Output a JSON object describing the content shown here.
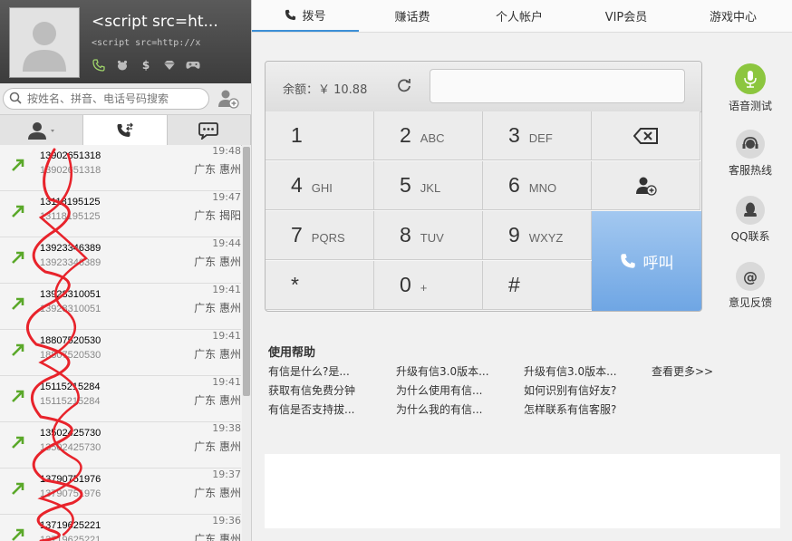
{
  "profile": {
    "name": "<script src=ht...",
    "sub": "<script src=http://x"
  },
  "search": {
    "placeholder": "按姓名、拼音、电话号码搜索"
  },
  "call_log": [
    {
      "number": "13902651318",
      "number_sub": "13902651318",
      "time": "19:48",
      "location": "广东 惠州"
    },
    {
      "number": "13118195125",
      "number_sub": "13118195125",
      "time": "19:47",
      "location": "广东 揭阳"
    },
    {
      "number": "13923346389",
      "number_sub": "13923346389",
      "time": "19:44",
      "location": "广东 惠州"
    },
    {
      "number": "13928310051",
      "number_sub": "13928310051",
      "time": "19:41",
      "location": "广东 惠州"
    },
    {
      "number": "18807520530",
      "number_sub": "18807520530",
      "time": "19:41",
      "location": "广东 惠州"
    },
    {
      "number": "15115215284",
      "number_sub": "15115215284",
      "time": "19:41",
      "location": "广东 惠州"
    },
    {
      "number": "13502425730",
      "number_sub": "13502425730",
      "time": "19:38",
      "location": "广东 惠州"
    },
    {
      "number": "13790751976",
      "number_sub": "13790751976",
      "time": "19:37",
      "location": "广东 惠州"
    },
    {
      "number": "13719625221",
      "number_sub": "13719625221",
      "time": "19:36",
      "location": "广东 惠州"
    }
  ],
  "tabs": [
    "拨号",
    "赚话费",
    "个人帐户",
    "VIP会员",
    "游戏中心"
  ],
  "dialer": {
    "balance": "余额：￥ 10.88",
    "keys": [
      {
        "d": "1",
        "l": ""
      },
      {
        "d": "2",
        "l": "ABC"
      },
      {
        "d": "3",
        "l": "DEF"
      },
      {
        "d": "4",
        "l": "GHI"
      },
      {
        "d": "5",
        "l": "JKL"
      },
      {
        "d": "6",
        "l": "MNO"
      },
      {
        "d": "7",
        "l": "PQRS"
      },
      {
        "d": "8",
        "l": "TUV"
      },
      {
        "d": "9",
        "l": "WXYZ"
      },
      {
        "d": "*",
        "l": ""
      },
      {
        "d": "0",
        "l": "+"
      },
      {
        "d": "#",
        "l": ""
      }
    ],
    "call_label": "呼叫"
  },
  "side": [
    "语音测试",
    "客服热线",
    "QQ联系",
    "意见反馈"
  ],
  "help": {
    "title": "使用帮助",
    "links": [
      "有信是什么?是...",
      "升级有信3.0版本...",
      "升级有信3.0版本...",
      "查看更多>>",
      "获取有信免费分钟",
      "为什么使用有信...",
      "如何识别有信好友?",
      "",
      "有信是否支持拔...",
      "为什么我的有信...",
      "怎样联系有信客服?",
      ""
    ]
  },
  "colors": {
    "accent": "#3c8fd6",
    "call_button": "#7aaee6",
    "missed_arrow": "#5aa829",
    "scribble": "#e8232b",
    "voice_test": "#8cc63f"
  }
}
